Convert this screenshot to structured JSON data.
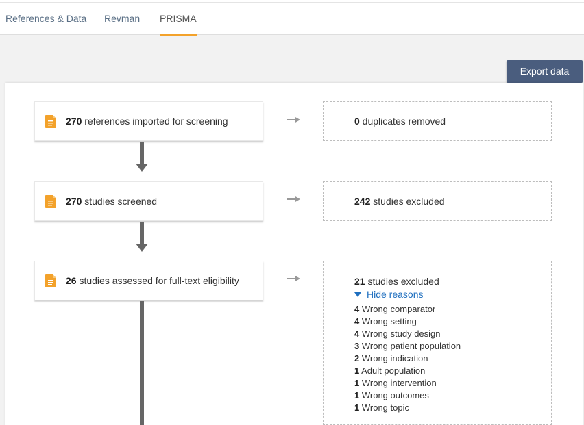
{
  "tabs": [
    {
      "label": "References & Data"
    },
    {
      "label": "Revman"
    },
    {
      "label": "PRISMA"
    }
  ],
  "export_label": "Export data",
  "flow": {
    "imported": {
      "count": "270",
      "text": " references imported for screening"
    },
    "duplicates": {
      "count": "0",
      "text": " duplicates removed"
    },
    "screened": {
      "count": "270",
      "text": " studies screened"
    },
    "screen_excluded": {
      "count": "242",
      "text": " studies excluded"
    },
    "fulltext": {
      "count": "26",
      "text": " studies assessed for full-text eligibility"
    },
    "fulltext_excluded": {
      "count": "21",
      "text": " studies excluded"
    },
    "hide_reasons_label": "Hide reasons",
    "reasons": [
      {
        "count": "4",
        "text": " Wrong comparator"
      },
      {
        "count": "4",
        "text": " Wrong setting"
      },
      {
        "count": "4",
        "text": " Wrong study design"
      },
      {
        "count": "3",
        "text": " Wrong patient population"
      },
      {
        "count": "2",
        "text": " Wrong indication"
      },
      {
        "count": "1",
        "text": " Adult population"
      },
      {
        "count": "1",
        "text": " Wrong intervention"
      },
      {
        "count": "1",
        "text": " Wrong outcomes"
      },
      {
        "count": "1",
        "text": " Wrong topic"
      }
    ]
  },
  "colors": {
    "accent": "#f3a22b",
    "button": "#4a5d7e",
    "link": "#1f6fbf",
    "doc_icon": "#f3a22b"
  },
  "icons": {
    "document": "document-icon",
    "right_arrow": "arrow-right-icon",
    "down_arrow": "arrow-down-icon",
    "triangle": "triangle-down-icon"
  }
}
